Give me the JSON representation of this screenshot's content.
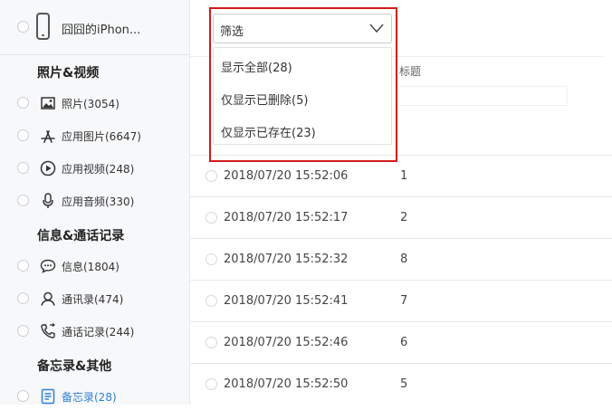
{
  "device": {
    "name": "囧囧的iPhon..."
  },
  "sidebar": {
    "sections": [
      {
        "title": "照片&视频"
      },
      {
        "title": "信息&通话记录"
      },
      {
        "title": "备忘录&其他"
      }
    ],
    "items": [
      {
        "label": "照片(3054)",
        "icon": "photo-icon"
      },
      {
        "label": "应用图片(6647)",
        "icon": "app-store-icon"
      },
      {
        "label": "应用视频(248)",
        "icon": "play-icon"
      },
      {
        "label": "应用音频(330)",
        "icon": "microphone-icon"
      },
      {
        "label": "信息(1804)",
        "icon": "message-icon"
      },
      {
        "label": "通讯录(474)",
        "icon": "contact-icon"
      },
      {
        "label": "通话记录(244)",
        "icon": "phone-call-icon"
      },
      {
        "label": "备忘录(28)",
        "icon": "notes-icon"
      }
    ],
    "active_color": "#2f7fd8"
  },
  "filter": {
    "label": "筛选",
    "options": [
      "显示全部(28)",
      "仅显示已删除(5)",
      "仅显示已存在(23)"
    ],
    "highlight_color": "#d11a1a"
  },
  "table": {
    "title_header": "标题",
    "rows": [
      {
        "time": "2018/07/20 15:52:06",
        "value": "1"
      },
      {
        "time": "2018/07/20 15:52:17",
        "value": "2"
      },
      {
        "time": "2018/07/20 15:52:32",
        "value": "8"
      },
      {
        "time": "2018/07/20 15:52:41",
        "value": "7"
      },
      {
        "time": "2018/07/20 15:52:46",
        "value": "6"
      },
      {
        "time": "2018/07/20 15:52:50",
        "value": "5"
      }
    ]
  }
}
